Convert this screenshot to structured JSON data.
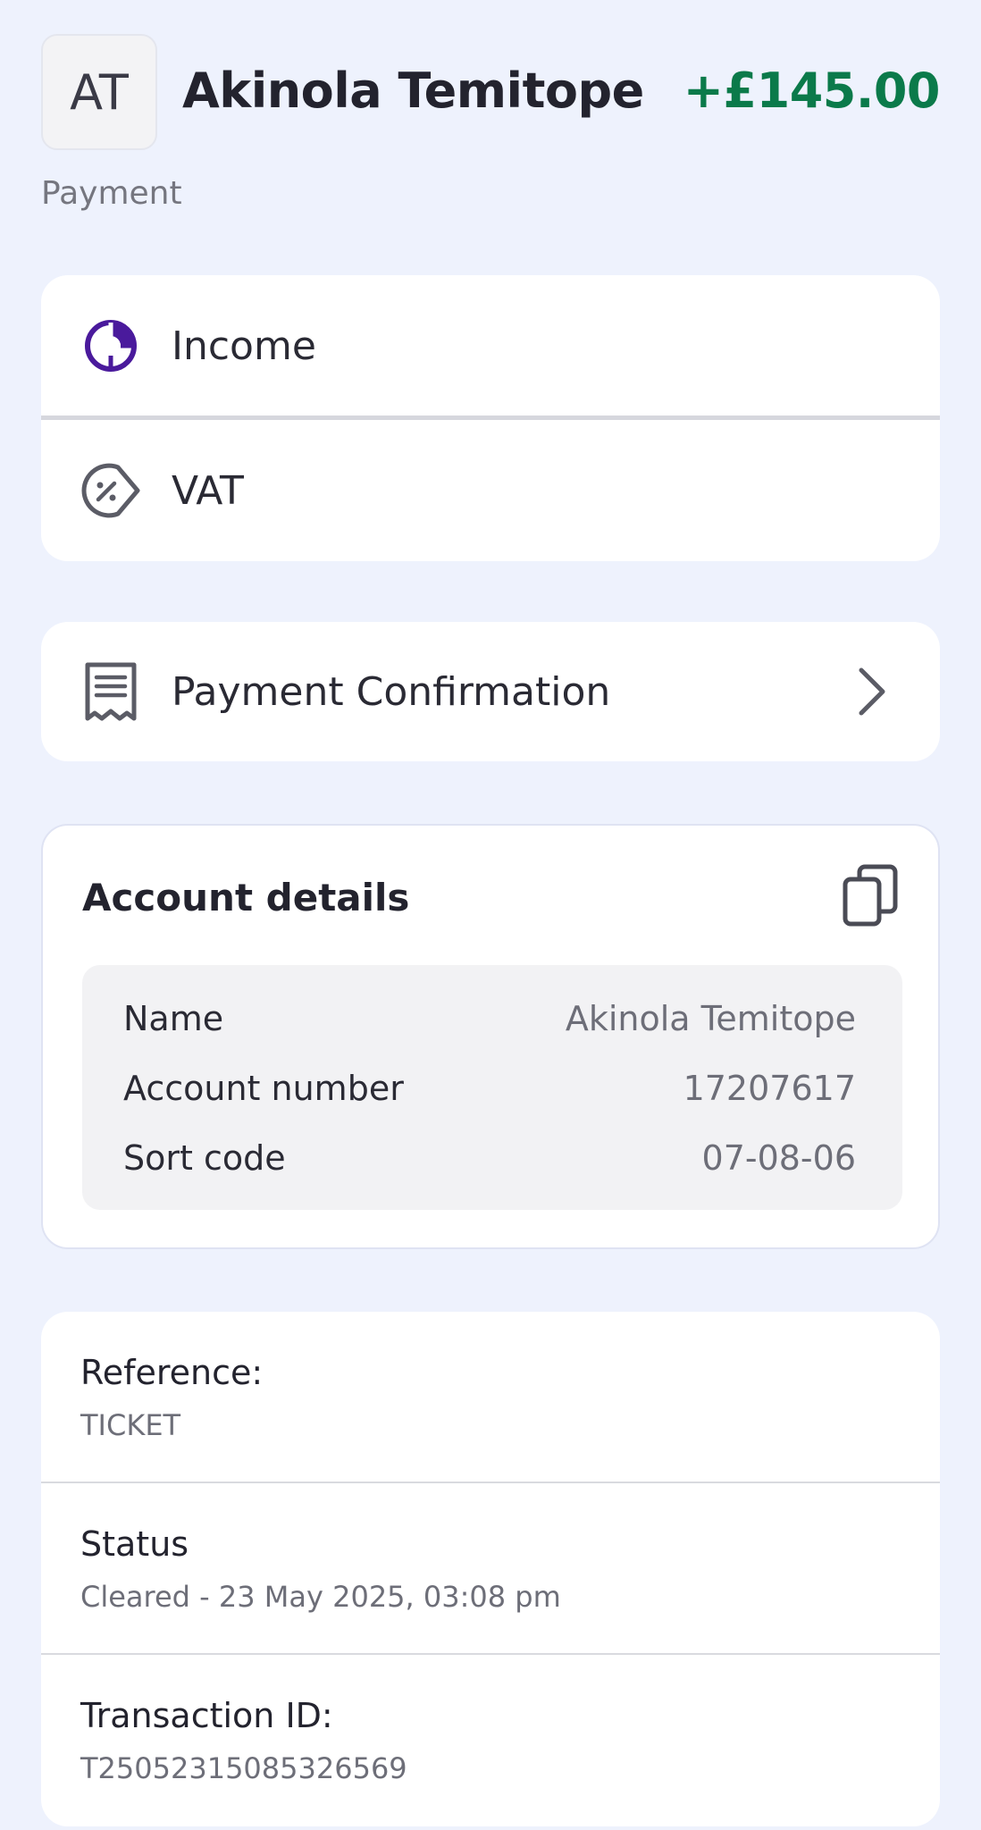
{
  "header": {
    "avatar_initials": "AT",
    "name": "Akinola Temitope",
    "amount": "+£145.00",
    "amount_color": "#0b7a4a",
    "subtitle": "Payment"
  },
  "categories": {
    "items": [
      {
        "label": "Income",
        "icon": "pie-chart-icon",
        "icon_color": "#4a1a9c"
      },
      {
        "label": "VAT",
        "icon": "percent-tag-icon",
        "icon_color": "#5b5c66"
      }
    ]
  },
  "confirmation": {
    "label": "Payment Confirmation",
    "icon": "receipt-icon",
    "action_icon": "chevron-right-icon"
  },
  "account_details": {
    "title": "Account details",
    "copy_icon": "copy-icon",
    "rows": [
      {
        "label": "Name",
        "value": "Akinola Temitope"
      },
      {
        "label": "Account number",
        "value": "17207617"
      },
      {
        "label": "Sort code",
        "value": "07-08-06"
      }
    ]
  },
  "info": {
    "reference_label": "Reference:",
    "reference_value": "TICKET",
    "status_label": "Status",
    "status_value": "Cleared - 23 May 2025, 03:08 pm",
    "transaction_label": "Transaction ID:",
    "transaction_value": "T25052315085326569"
  },
  "colors": {
    "background": "#eef2fd",
    "card": "#ffffff",
    "brand_purple": "#4a1a9c"
  }
}
